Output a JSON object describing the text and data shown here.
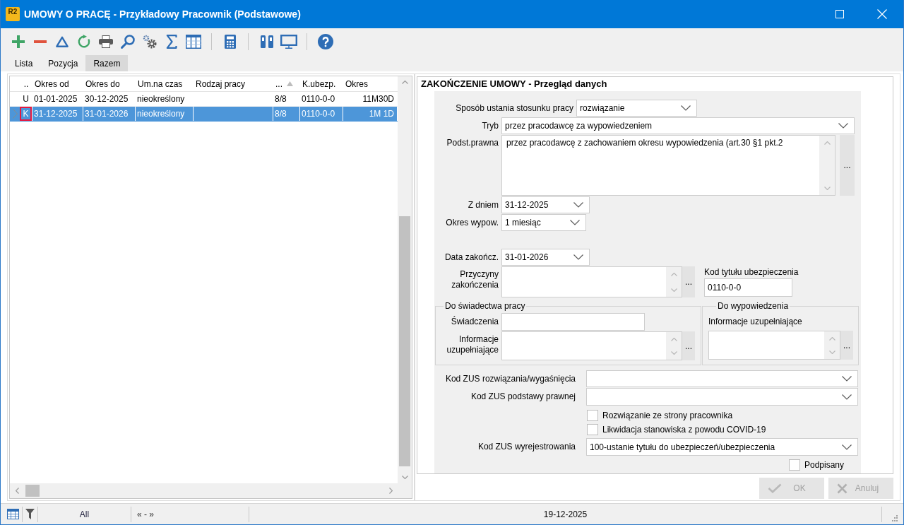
{
  "window": {
    "logo": "R2",
    "title": "UMOWY O PRACĘ - Przykładowy Pracownik (Podstawowe)"
  },
  "tabs": [
    {
      "label": "Lista",
      "selected": false
    },
    {
      "label": "Pozycja",
      "selected": false
    },
    {
      "label": "Razem",
      "selected": true
    }
  ],
  "table": {
    "columns": [
      {
        "label": "..",
        "sorted": false
      },
      {
        "label": "Okres od",
        "sorted": false
      },
      {
        "label": "Okres do",
        "sorted": false
      },
      {
        "label": "Um.na czas",
        "sorted": false
      },
      {
        "label": "Rodzaj pracy",
        "sorted": false
      },
      {
        "label": "...",
        "sorted": true
      },
      {
        "label": "K.ubezp.",
        "sorted": false
      },
      {
        "label": "Okres",
        "sorted": false
      }
    ],
    "rows": [
      {
        "cells": [
          "U",
          "01-01-2025",
          "30-12-2025",
          "nieokreślony",
          null,
          "8/8",
          "0110-0-0",
          "11M30D"
        ],
        "selected": false,
        "current": false
      },
      {
        "cells": [
          "K",
          "31-12-2025",
          "31-01-2026",
          "nieokreślony",
          null,
          "8/8",
          "0110-0-0",
          "1M 1D"
        ],
        "selected": true,
        "current": true
      }
    ]
  },
  "detail": {
    "title": "ZAKOŃCZENIE UMOWY - Przegląd danych",
    "termination_method": {
      "label": "Sposób ustania stosunku pracy",
      "value": "rozwiązanie"
    },
    "mode": {
      "label": "Tryb",
      "value": "przez pracodawcę za wypowiedzeniem"
    },
    "legal_basis": {
      "label": "Podst.prawna",
      "value": "przez pracodawcę z zachowaniem okresu wypowiedzenia (art.30 §1 pkt.2",
      "button": "..."
    },
    "notice_date": {
      "label": "Z dniem",
      "value": "31-12-2025"
    },
    "notice_period": {
      "label": "Okres wypow.",
      "value": "1 miesiąc"
    },
    "end_date": {
      "label": "Data zakończ.",
      "value": "31-01-2026"
    },
    "end_reasons": {
      "label": "Przyczyny zakończenia",
      "button": "..."
    },
    "insurance_code": {
      "label": "Kod tytułu ubezpieczenia",
      "value": "0110-0-0"
    },
    "certificate_group": {
      "title": "Do świadectwa pracy",
      "benefits": {
        "label": "Świadczenia"
      },
      "additional_info": {
        "label": "Informacje uzupełniające",
        "button": "..."
      }
    },
    "notice_group": {
      "title": "Do wypowiedzenia",
      "additional_info": {
        "label": "Informacje uzupełniające",
        "button": "..."
      }
    },
    "zus_termination_code": {
      "label": "Kod ZUS rozwiązania/wygaśnięcia"
    },
    "zus_legal_basis_code": {
      "label": "Kod ZUS podstawy prawnej"
    },
    "checkboxes": [
      {
        "label": "Rozwiązanie ze strony pracownika",
        "checked": false
      },
      {
        "label": "Likwidacja stanowiska z powodu COVID-19",
        "checked": false
      }
    ],
    "zus_deregistration_code": {
      "label": "Kod ZUS wyrejestrowania",
      "value": "100-ustanie tytułu do ubezpieczeń/ubezpieczenia"
    },
    "signed": {
      "label": "Podpisany",
      "checked": false
    }
  },
  "buttons": [
    {
      "kind": "ok",
      "label": "OK",
      "disabled": true
    },
    {
      "kind": "cancel",
      "label": "Anuluj",
      "disabled": true
    }
  ],
  "status_bar": {
    "filter": "All",
    "navigator": "« - »",
    "date": "19-12-2025"
  }
}
